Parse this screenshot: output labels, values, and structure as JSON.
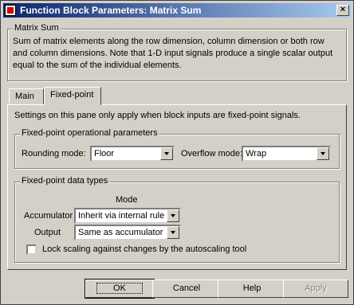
{
  "window": {
    "title": "Function Block Parameters: Matrix Sum"
  },
  "block": {
    "name": "Matrix Sum",
    "description": "Sum of matrix elements along the row dimension, column dimension or both row and column dimensions. Note that 1-D input signals produce a single scalar output equal to the sum of the individual elements."
  },
  "tabs": [
    {
      "label": "Main"
    },
    {
      "label": "Fixed-point"
    }
  ],
  "pane": {
    "note": "Settings on this pane only apply when block inputs are fixed-point signals.",
    "operational": {
      "title": "Fixed-point operational parameters",
      "rounding_label": "Rounding mode:",
      "rounding_value": "Floor",
      "overflow_label": "Overflow mode:",
      "overflow_value": "Wrap"
    },
    "datatypes": {
      "title": "Fixed-point data types",
      "mode_header": "Mode",
      "accumulator_label": "Accumulator",
      "accumulator_value": "Inherit via internal rule",
      "output_label": "Output",
      "output_value": "Same as accumulator",
      "lock_label": "Lock scaling against changes by the autoscaling tool"
    }
  },
  "buttons": {
    "ok": "OK",
    "cancel": "Cancel",
    "help": "Help",
    "apply": "Apply"
  }
}
